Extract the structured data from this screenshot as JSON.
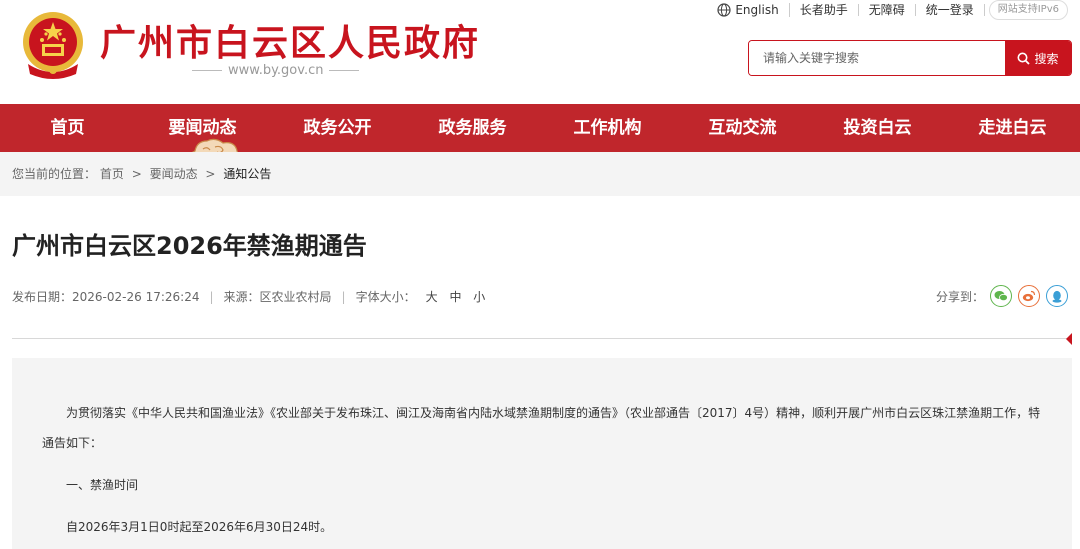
{
  "header": {
    "site_title": "广州市白云区人民政府",
    "site_url": "www.by.gov.cn",
    "top_links": [
      "English",
      "长者助手",
      "无障碍",
      "统一登录"
    ],
    "ipv6_badge": "网站支持IPv6"
  },
  "search": {
    "placeholder": "请输入关键字搜索",
    "button_label": "搜索"
  },
  "nav": {
    "items": [
      "首页",
      "要闻动态",
      "政务公开",
      "政务服务",
      "工作机构",
      "互动交流",
      "投资白云",
      "走进白云"
    ]
  },
  "breadcrumb": {
    "prefix": "您当前的位置：",
    "items": [
      "首页",
      "要闻动态",
      "通知公告"
    ],
    "separator": ">"
  },
  "article": {
    "title": "广州市白云区2026年禁渔期通告",
    "publish_label": "发布日期：",
    "publish_date": "2026-02-26 17:26:24",
    "source_label": "来源：",
    "source": "区农业农村局",
    "font_size_label": "字体大小：",
    "font_sizes": [
      "大",
      "中",
      "小"
    ],
    "share_label": "分享到：",
    "paragraphs": [
      "为贯彻落实《中华人民共和国渔业法》《农业部关于发布珠江、闽江及海南省内陆水域禁渔期制度的通告》（农业部通告〔2017〕4号）精神，顺利开展广州市白云区珠江禁渔期工作，特通告如下：",
      "一、禁渔时间",
      "自2026年3月1日0时起至2026年6月30日24时。"
    ]
  },
  "colors": {
    "brand_red": "#c8141e",
    "nav_red": "#c0262c",
    "wechat_green": "#5fb54d",
    "weibo_orange": "#e8703a",
    "qq_blue": "#3a9fd6"
  },
  "icons": [
    "national-emblem-icon",
    "globe-icon",
    "search-icon",
    "cloud-ornament-icon",
    "wechat-icon",
    "weibo-icon",
    "qq-icon"
  ]
}
